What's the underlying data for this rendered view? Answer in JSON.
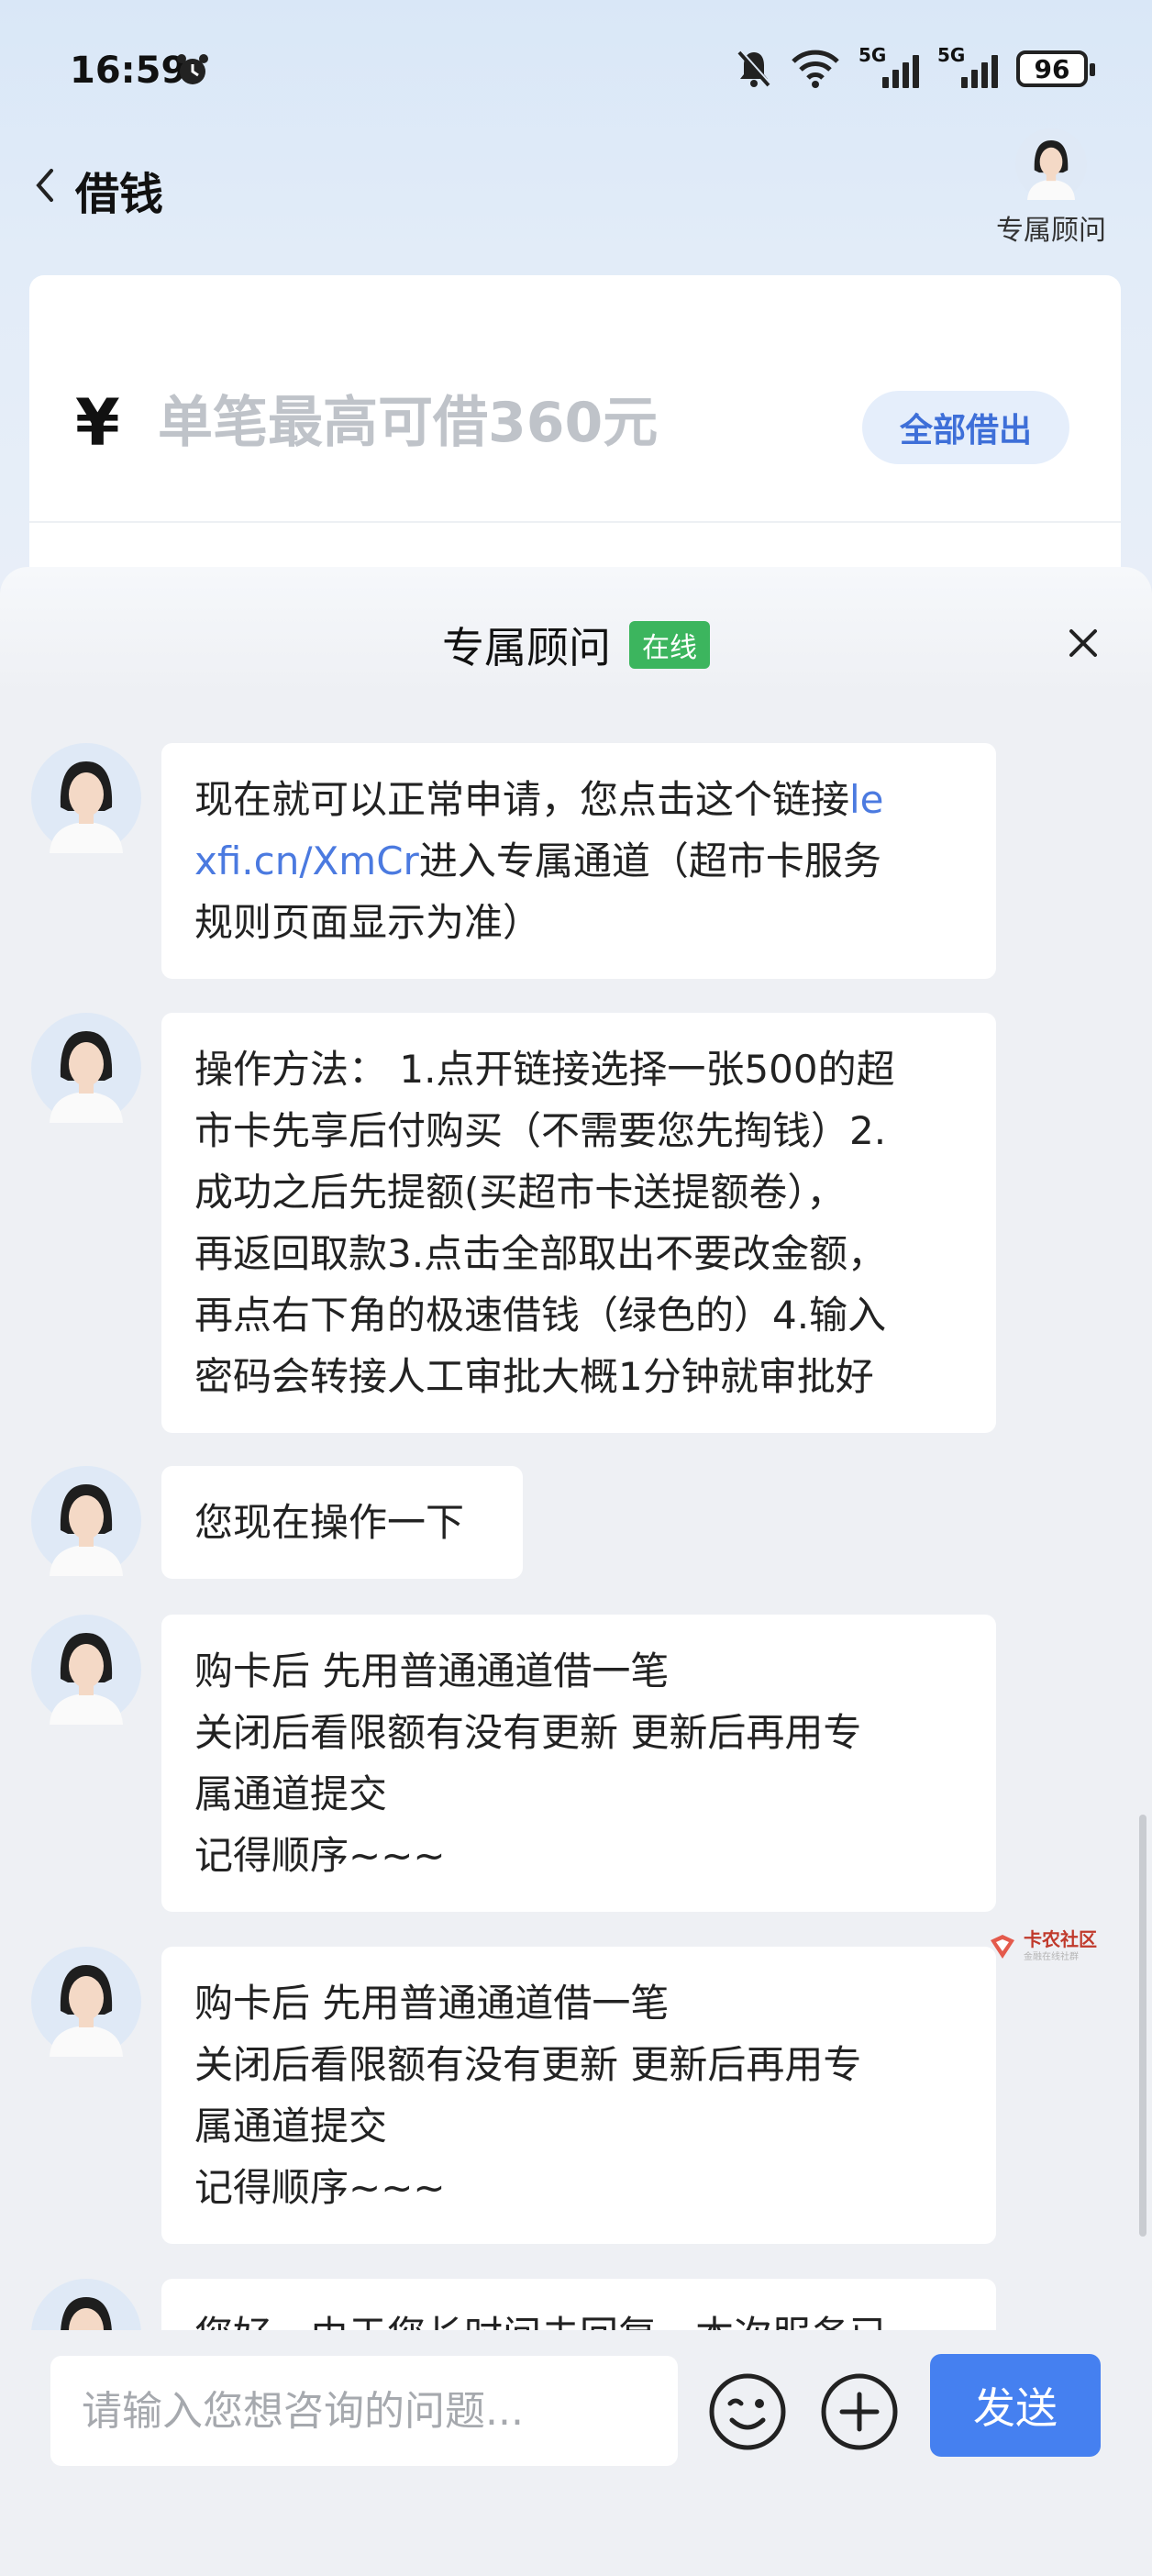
{
  "status_bar": {
    "time": "16:59",
    "battery": "96",
    "signal_1": "5G",
    "signal_2": "5G"
  },
  "header": {
    "title": "借钱",
    "advisor_label": "专属顾问"
  },
  "loan_card": {
    "currency": "¥",
    "amount_placeholder": "单笔最高可借360元",
    "borrow_all_label": "全部借出"
  },
  "chat": {
    "title": "专属顾问",
    "status_badge": "在线",
    "messages": [
      {
        "lines": [
          [
            {
              "t": "现在就可以正常申请，您点击这个链接"
            },
            {
              "t": "le",
              "link": true
            }
          ],
          [
            {
              "t": "xfi.cn/XmCr",
              "link": true
            },
            {
              "t": "进入专属通道（超市卡服务"
            }
          ],
          [
            {
              "t": "规则页面显示为准）"
            }
          ]
        ]
      },
      {
        "lines": [
          [
            {
              "t": "操作方法： 1.点开链接选择一张500的超"
            }
          ],
          [
            {
              "t": "市卡先享后付购买（不需要您先掏钱）2."
            }
          ],
          [
            {
              "t": "成功之后先提额(买超市卡送提额卷），"
            }
          ],
          [
            {
              "t": "再返回取款3.点击全部取出不要改金额，"
            }
          ],
          [
            {
              "t": "再点右下角的极速借钱（绿色的）4.输入"
            }
          ],
          [
            {
              "t": "密码会转接人工审批大概1分钟就审批好"
            }
          ]
        ]
      },
      {
        "lines": [
          [
            {
              "t": "您现在操作一下"
            }
          ]
        ]
      },
      {
        "lines": [
          [
            {
              "t": "购卡后 先用普通通道借一笔"
            }
          ],
          [
            {
              "t": "关闭后看限额有没有更新 更新后再用专"
            }
          ],
          [
            {
              "t": "属通道提交"
            }
          ],
          [
            {
              "t": "记得顺序~~~"
            }
          ]
        ]
      },
      {
        "lines": [
          [
            {
              "t": "购卡后 先用普通通道借一笔"
            }
          ],
          [
            {
              "t": "关闭后看限额有没有更新 更新后再用专"
            }
          ],
          [
            {
              "t": "属通道提交"
            }
          ],
          [
            {
              "t": "记得顺序~~~"
            }
          ]
        ]
      },
      {
        "lines": [
          [
            {
              "t": "您好，由于您长时间未回复，本次服务已"
            }
          ]
        ]
      }
    ]
  },
  "input_bar": {
    "placeholder": "请输入您想咨询的问题...",
    "send_label": "发送"
  },
  "watermark": {
    "text": "卡农社区",
    "subtext": "金融在线社群"
  },
  "colors": {
    "accent": "#4580f0",
    "link": "#4b7ae0",
    "online": "#3cb55e"
  }
}
